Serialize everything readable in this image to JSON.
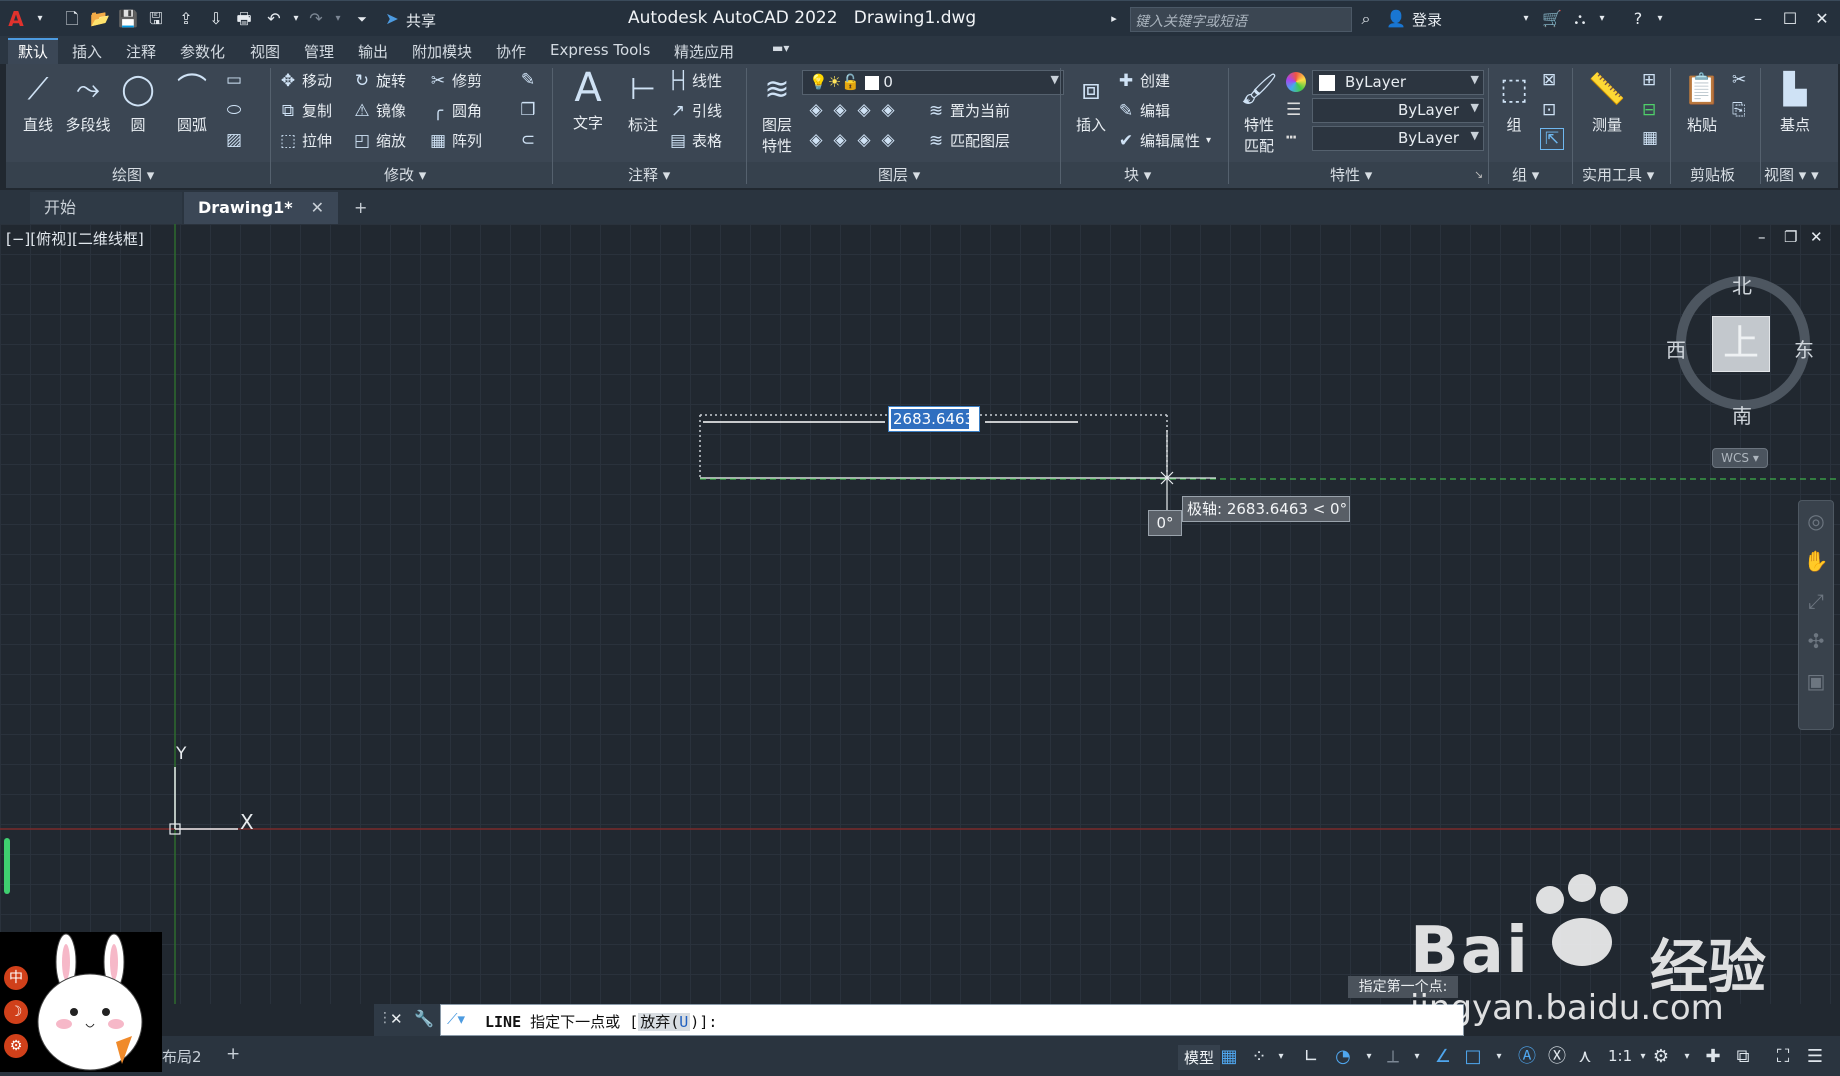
{
  "titlebar": {
    "app_title": "Autodesk AutoCAD 2022",
    "doc_title": "Drawing1.dwg",
    "share_label": "共享",
    "search_placeholder": "键入关键字或短语",
    "login_label": "登录"
  },
  "ribbon_tabs": [
    "默认",
    "插入",
    "注释",
    "参数化",
    "视图",
    "管理",
    "输出",
    "附加模块",
    "协作",
    "Express Tools",
    "精选应用"
  ],
  "ribbon": {
    "draw": {
      "title": "绘图",
      "line": "直线",
      "polyline": "多段线",
      "circle": "圆",
      "arc": "圆弧"
    },
    "modify": {
      "title": "修改",
      "move": "移动",
      "rotate": "旋转",
      "trim": "修剪",
      "copy": "复制",
      "mirror": "镜像",
      "fillet": "圆角",
      "stretch": "拉伸",
      "scale": "缩放",
      "array": "阵列"
    },
    "annotation": {
      "title": "注释",
      "text": "文字",
      "dimension": "标注",
      "linear": "线性",
      "leader": "引线",
      "table": "表格"
    },
    "layers": {
      "title": "图层",
      "layer_properties_1": "图层",
      "layer_properties_2": "特性",
      "current_layer": "0",
      "make_current": "置为当前",
      "match_layer": "匹配图层"
    },
    "block": {
      "title": "块",
      "insert": "插入",
      "create": "创建",
      "edit": "编辑",
      "edit_attributes": "编辑属性"
    },
    "properties": {
      "title": "特性",
      "match_1": "特性",
      "match_2": "匹配",
      "color": "ByLayer",
      "lineweight": "ByLayer",
      "linetype": "ByLayer"
    },
    "groups": {
      "title": "组",
      "group": "组"
    },
    "utilities": {
      "title": "实用工具",
      "measure": "测量"
    },
    "clipboard": {
      "title": "剪贴板",
      "paste": "粘贴"
    },
    "view": {
      "title": "视图",
      "base": "基点"
    }
  },
  "doc_tabs": {
    "start": "开始",
    "drawing": "Drawing1*"
  },
  "viewport": {
    "label": "[−][俯视][二维线框]",
    "dynamic_input": "2683.6463",
    "angle": "0°",
    "polar_tooltip": "极轴: 2683.6463 < 0°",
    "ucs_x": "X",
    "ucs_y": "Y"
  },
  "viewcube": {
    "north": "北",
    "south": "南",
    "east": "东",
    "west": "西",
    "top": "上",
    "wcs": "WCS"
  },
  "hint": "指定第一个点:",
  "command_line": {
    "command": "LINE",
    "prompt": "指定下一点或",
    "option_open": "[",
    "option_text": "放弃(",
    "option_key": "U",
    "option_close": ")]:"
  },
  "status": {
    "layout2": "布局2",
    "model": "模型",
    "scale": "1:1"
  },
  "watermark": {
    "brand": "Bai",
    "brand2": "经验",
    "url": "jingyan.baidu.com"
  },
  "mascot": {
    "ime": "中"
  },
  "colors": {
    "accent": "#4d9be0",
    "polar_track": "#3fb04a",
    "x_axis": "#7a2a2a",
    "y_axis": "#2d6b2d"
  }
}
